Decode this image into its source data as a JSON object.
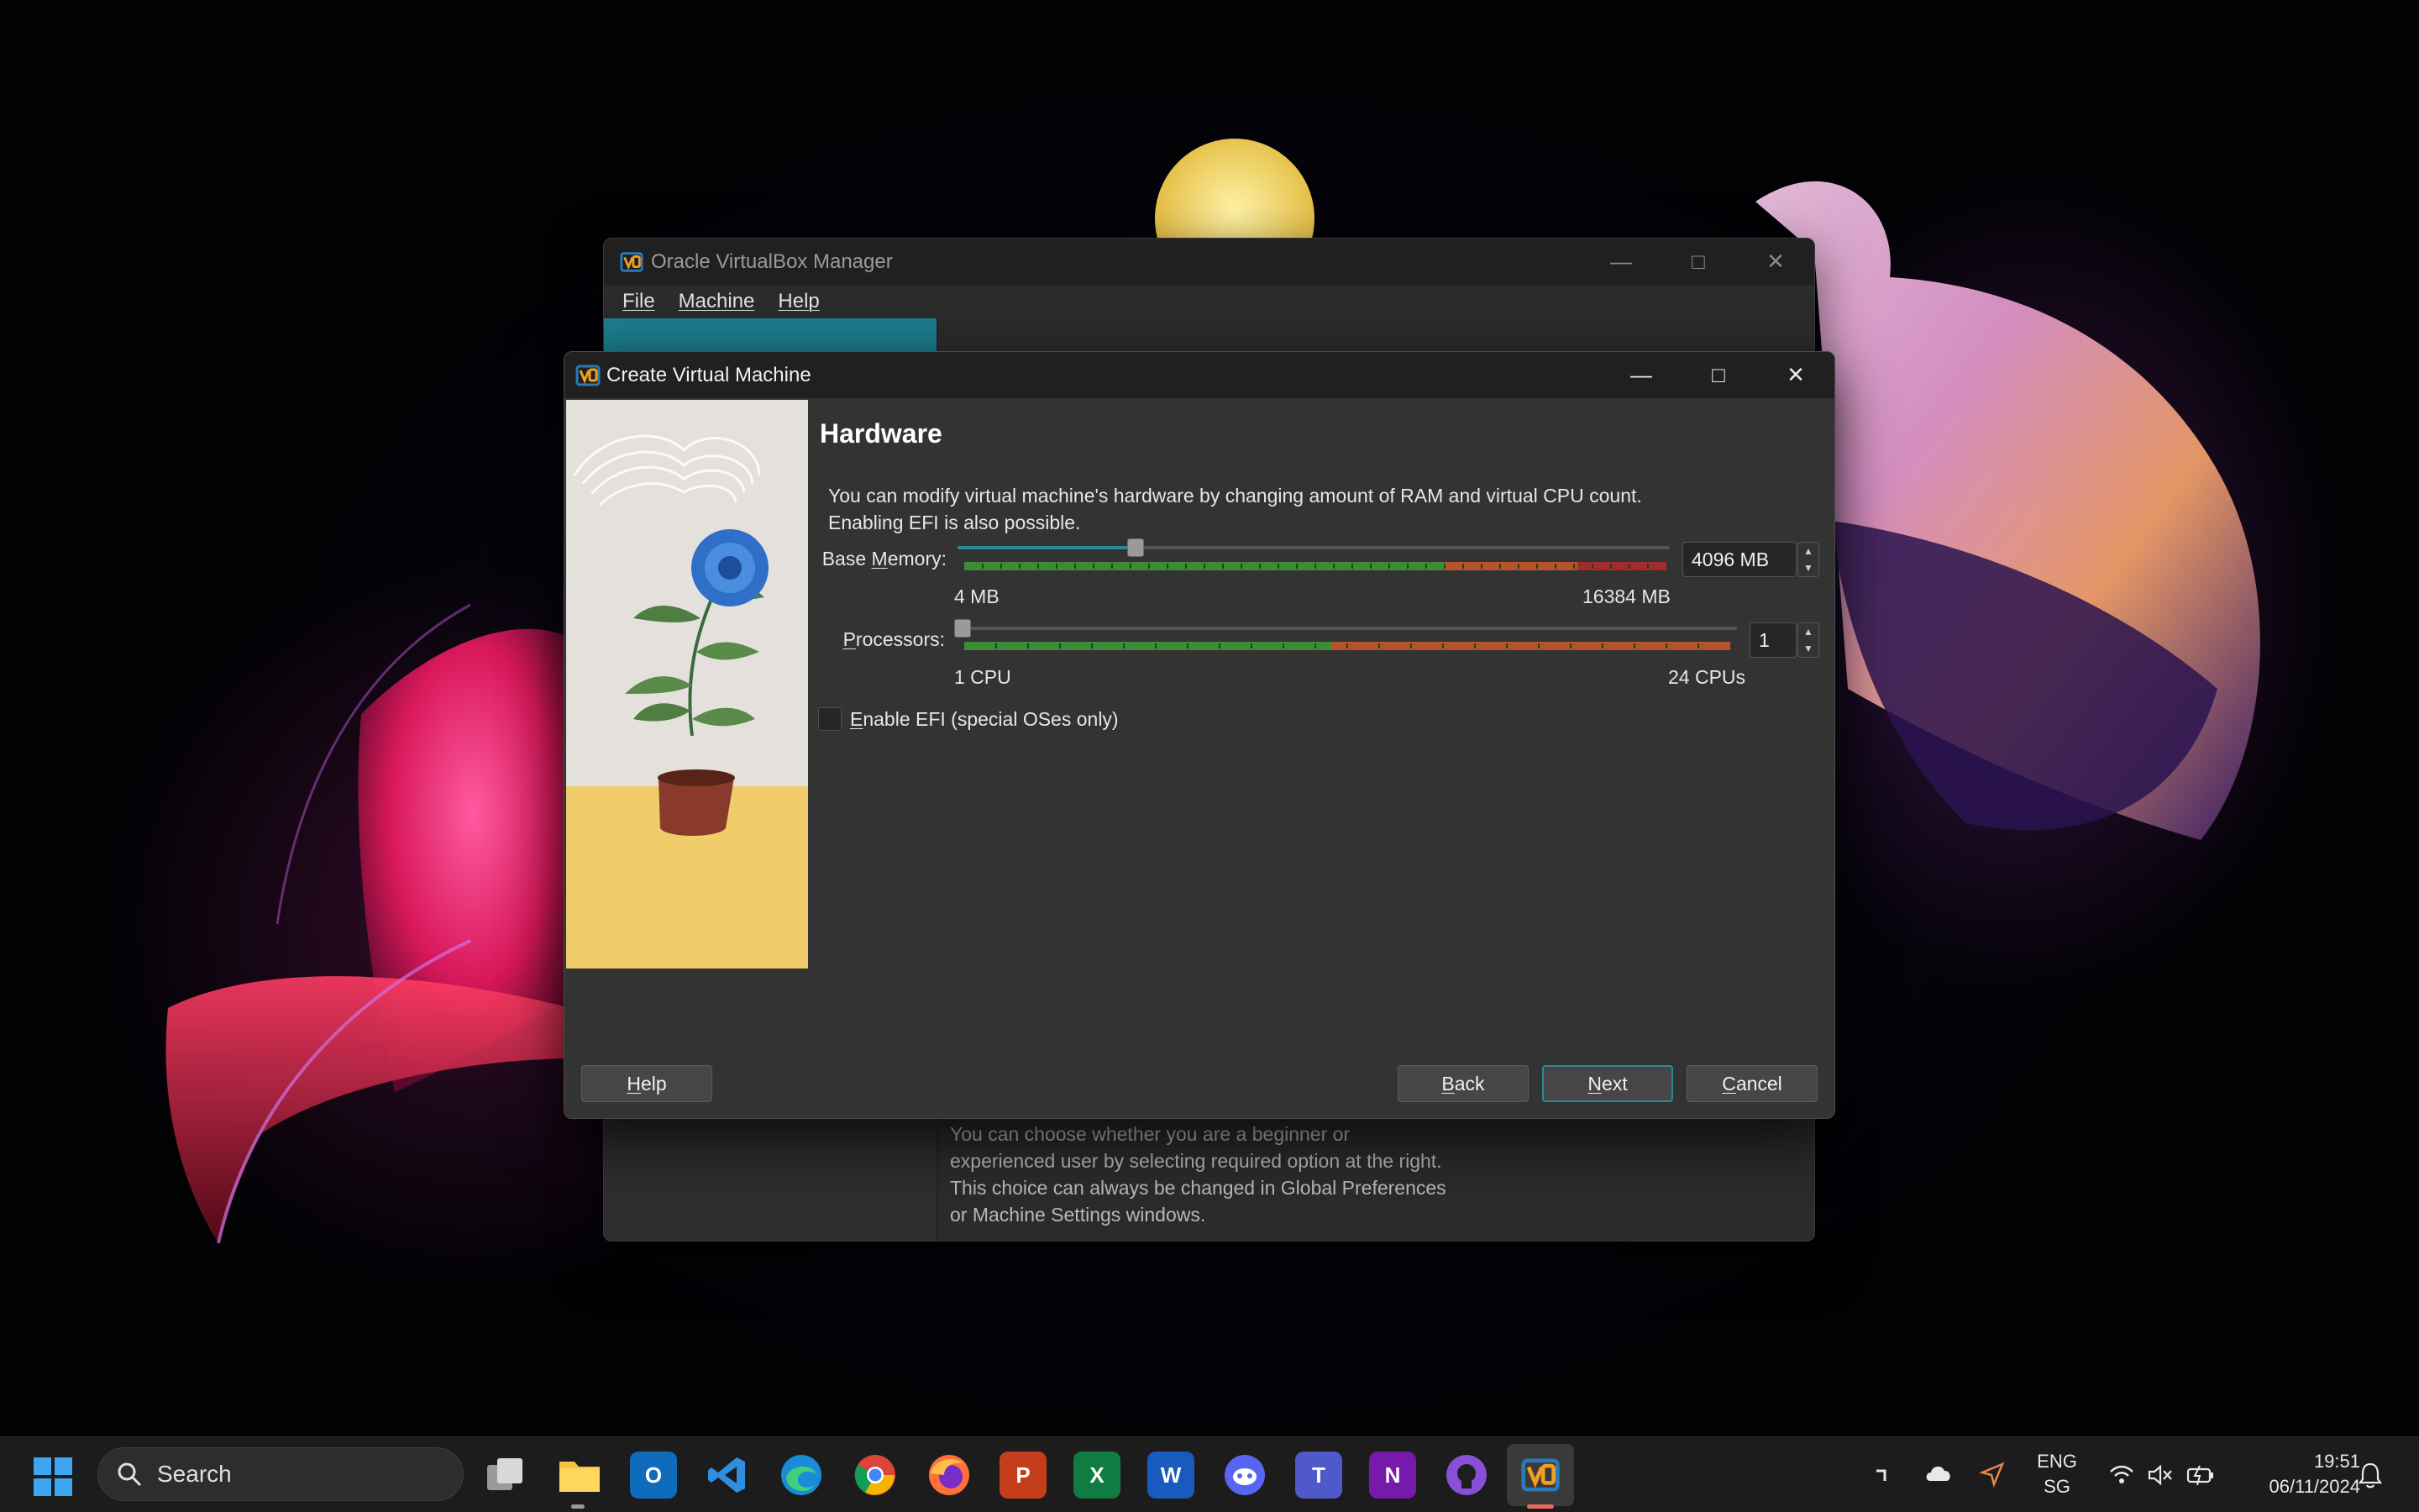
{
  "manager_window": {
    "title": "Oracle VirtualBox Manager",
    "menu": [
      "File",
      "Machine",
      "Help"
    ],
    "description": "You can choose whether you are a beginner or experienced user by selecting required option at the right. This choice can always be changed in Global Preferences or Machine Settings windows."
  },
  "dialog": {
    "title": "Create Virtual Machine",
    "heading": "Hardware",
    "description": "You can modify virtual machine's hardware by changing amount of RAM and virtual CPU count. Enabling EFI is also possible.",
    "base_memory": {
      "label_pre": "Base ",
      "label_accel": "M",
      "label_post": "emory:",
      "value": "4096 MB",
      "min_label": "4 MB",
      "max_label": "16384 MB",
      "fraction": 0.25
    },
    "processors": {
      "label_accel": "P",
      "label_post": "rocessors:",
      "value": "1",
      "min_label": "1 CPU",
      "max_label": "24 CPUs",
      "fraction": 0.0
    },
    "efi": {
      "label_accel": "E",
      "label_post": "nable EFI (special OSes only)",
      "checked": false
    },
    "buttons": {
      "help_accel": "H",
      "help_rest": "elp",
      "back_accel": "B",
      "back_rest": "ack",
      "next_accel": "N",
      "next_rest": "ext",
      "cancel_accel": "C",
      "cancel_rest": "ancel"
    },
    "colors": {
      "accent": "#2a8a9a",
      "green": "#3d8b37",
      "orange": "#b5542a",
      "red": "#a32b2b"
    }
  },
  "taskbar": {
    "search_label": "Search",
    "apps": [
      "task-view",
      "file-explorer",
      "outlook",
      "vscode",
      "edge",
      "chrome",
      "firefox",
      "powerpoint",
      "excel",
      "word",
      "discord",
      "teams",
      "onenote",
      "github-desktop",
      "virtualbox"
    ],
    "tray": {
      "lang_line1": "ENG",
      "lang_line2": "SG",
      "time": "19:51",
      "date": "06/11/2024"
    }
  }
}
